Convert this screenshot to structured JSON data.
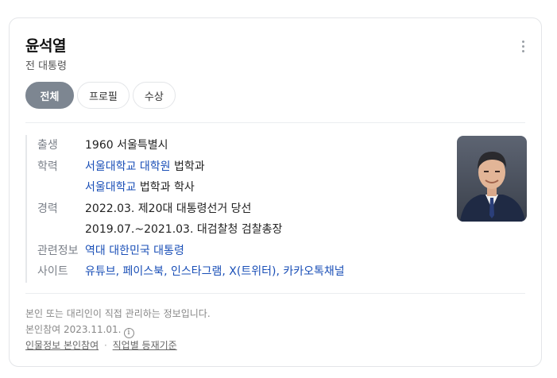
{
  "header": {
    "name": "윤석열",
    "subtitle": "전 대통령"
  },
  "tabs": [
    {
      "label": "전체",
      "active": true
    },
    {
      "label": "프로필",
      "active": false
    },
    {
      "label": "수상",
      "active": false
    }
  ],
  "info": {
    "birth": {
      "label": "출생",
      "value": "1960 서울특별시"
    },
    "education": {
      "label": "학력",
      "items": [
        {
          "link": "서울대학교 대학원",
          "text": " 법학과"
        },
        {
          "link": "서울대학교",
          "text": " 법학과 학사"
        }
      ]
    },
    "career": {
      "label": "경력",
      "items": [
        "2022.03. 제20대 대통령선거 당선",
        "2019.07.~2021.03. 대검찰청 검찰총장"
      ]
    },
    "related": {
      "label": "관련정보",
      "link": "역대 대한민국 대통령"
    },
    "sites": {
      "label": "사이트",
      "links": [
        "유튜브",
        "페이스북",
        "인스타그램",
        "X(트위터)",
        "카카오톡채널"
      ],
      "separator": ", "
    }
  },
  "footer": {
    "notice": "본인 또는 대리인이 직접 관리하는 정보입니다.",
    "participation": "본인참여 2023.11.01.",
    "link1": "인물정보 본인참여",
    "sep": "·",
    "link2": "직업별 등재기준"
  },
  "icons": {
    "more": "more-vertical-icon",
    "info": "info-icon"
  },
  "colors": {
    "link": "#1a4fb7",
    "activeTab": "#7d8691"
  }
}
